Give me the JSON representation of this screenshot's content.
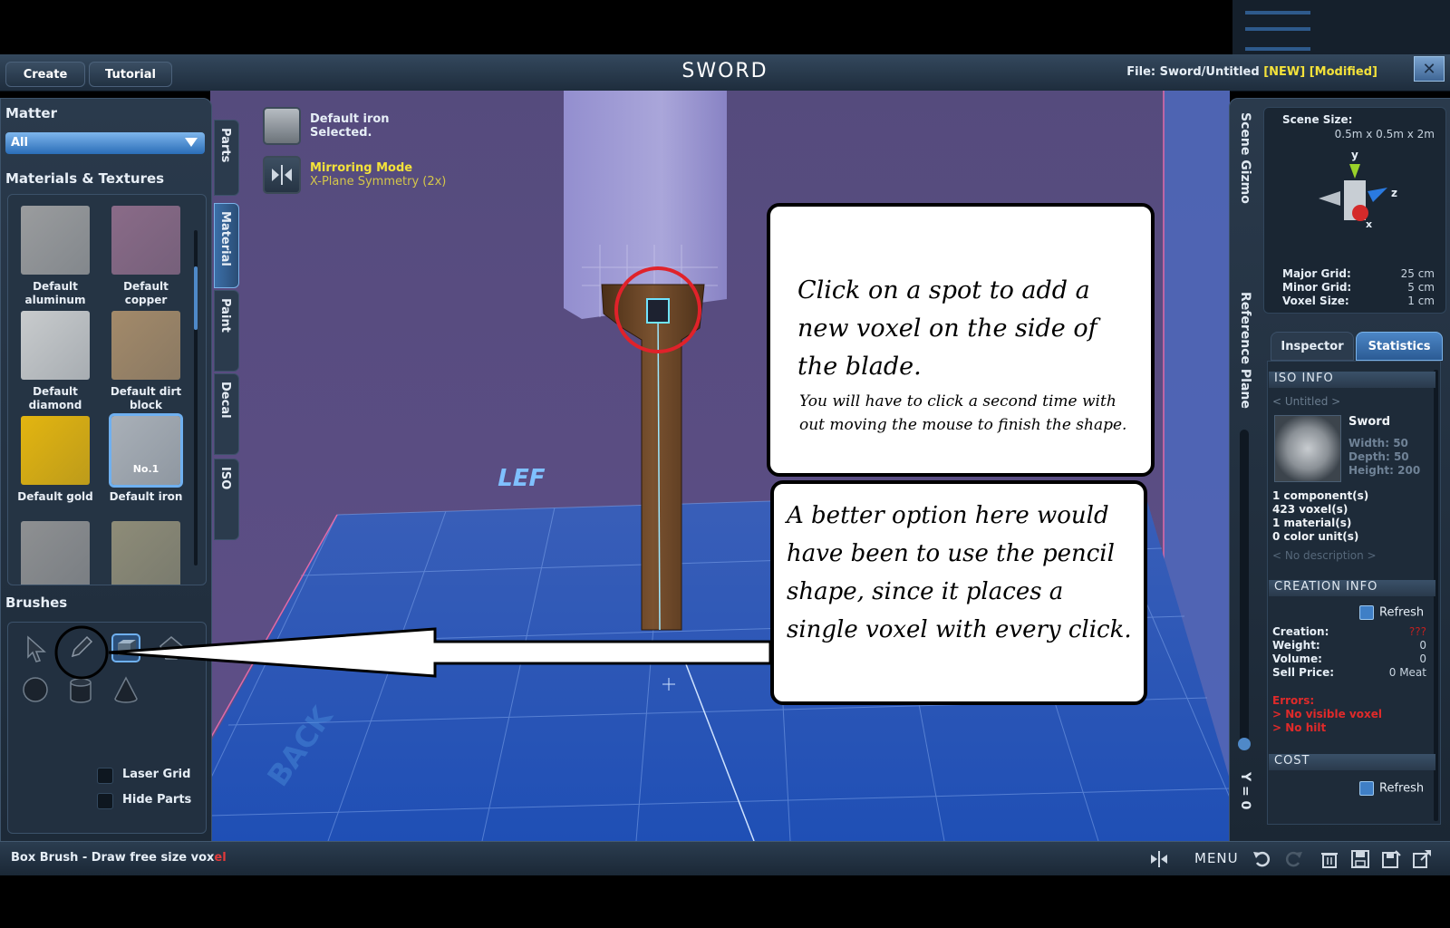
{
  "header": {
    "tabs": [
      {
        "label": "Create"
      },
      {
        "label": "Tutorial"
      }
    ],
    "title": "SWORD",
    "file_label": "File:",
    "file_name": "Sword/Untitled",
    "flag_new": "[NEW]",
    "flag_modified": "[Modified]",
    "close_icon": "close-icon"
  },
  "left_panel": {
    "matter_heading": "Matter",
    "matter_value": "All",
    "materials_heading": "Materials & Textures",
    "materials": [
      {
        "line1": "Default",
        "line2": "aluminum",
        "color": "#9a9c9e"
      },
      {
        "line1": "Default",
        "line2": "copper",
        "color": "#8a6b88"
      },
      {
        "line1": "Default",
        "line2": "diamond",
        "color": "#c8cbcd"
      },
      {
        "line1": "Default dirt",
        "line2": "block",
        "color": "#a38a6a"
      },
      {
        "line1": "Default gold",
        "line2": "",
        "color": "#e3b510"
      },
      {
        "line1": "Default iron",
        "line2": "",
        "color": "#a9b0b8",
        "badge": "No.1"
      },
      {
        "line1": "",
        "line2": "",
        "color": "#8e9092"
      },
      {
        "line1": "",
        "line2": "",
        "color": "#8e8c78"
      }
    ],
    "brushes_heading": "Brushes",
    "laser_grid": "Laser Grid",
    "hide_parts": "Hide Parts"
  },
  "side_tabs": [
    {
      "label": "Parts"
    },
    {
      "label": "Material",
      "active": true
    },
    {
      "label": "Paint"
    },
    {
      "label": "Decal"
    },
    {
      "label": "ISO"
    }
  ],
  "status": {
    "material_line1": "Default iron",
    "material_line2": "Selected.",
    "mirror_title": "Mirroring Mode",
    "mirror_detail": "X-Plane Symmetry (2x)"
  },
  "viewport": {
    "floor_label_left": "LEF",
    "floor_label_back": "BACK"
  },
  "callouts": {
    "top_main": "Click on a spot to add a new voxel on the side of the blade.",
    "top_note": "You will have to click a second time with out moving the mouse to finish the shape.",
    "bottom": "A better option here would have been to use the pencil shape, since it places a single voxel with every click."
  },
  "right_panel": {
    "scene_gizmo_label": "Scene Gizmo",
    "reference_plane_label": "Reference Plane",
    "y_label": "Y = 0",
    "scene_size_label": "Scene Size:",
    "scene_size_value": "0.5m x 0.5m x 2m",
    "axis_y": "y",
    "axis_z": "z",
    "axis_x": "x",
    "major_grid_label": "Major Grid:",
    "major_grid_value": "25 cm",
    "minor_grid_label": "Minor Grid:",
    "minor_grid_value": "5 cm",
    "voxel_size_label": "Voxel Size:",
    "voxel_size_value": "1 cm",
    "tab_inspector": "Inspector",
    "tab_statistics": "Statistics",
    "iso_info_heading": "ISO INFO",
    "iso_untitled": "< Untitled >",
    "iso_name": "Sword",
    "iso_width": "Width: 50",
    "iso_depth": "Depth: 50",
    "iso_height": "Height: 200",
    "components": "1 component(s)",
    "voxels": "423 voxel(s)",
    "materials_count": "1 material(s)",
    "color_units": "0 color unit(s)",
    "no_description": "< No description >",
    "creation_info_heading": "CREATION INFO",
    "refresh": "Refresh",
    "creation_label": "Creation:",
    "creation_value": "???",
    "weight_label": "Weight:",
    "weight_value": "0",
    "volume_label": "Volume:",
    "volume_value": "0",
    "sell_price_label": "Sell Price:",
    "sell_price_value": "0 Meat",
    "errors_label": "Errors:",
    "error1": "> No visible voxel",
    "error2": "> No hilt",
    "cost_heading": "COST"
  },
  "bottom_bar": {
    "status_prefix": "Box Brush - Draw free size vox",
    "status_suffix": "el",
    "menu_label": "MENU"
  },
  "colors": {
    "accent_blue": "#3f7fc6",
    "highlight_yellow": "#f4e23a",
    "error_red": "#e02a2a",
    "viewport_purple": "#5a4f82",
    "floor_blue": "#2a55b5"
  }
}
